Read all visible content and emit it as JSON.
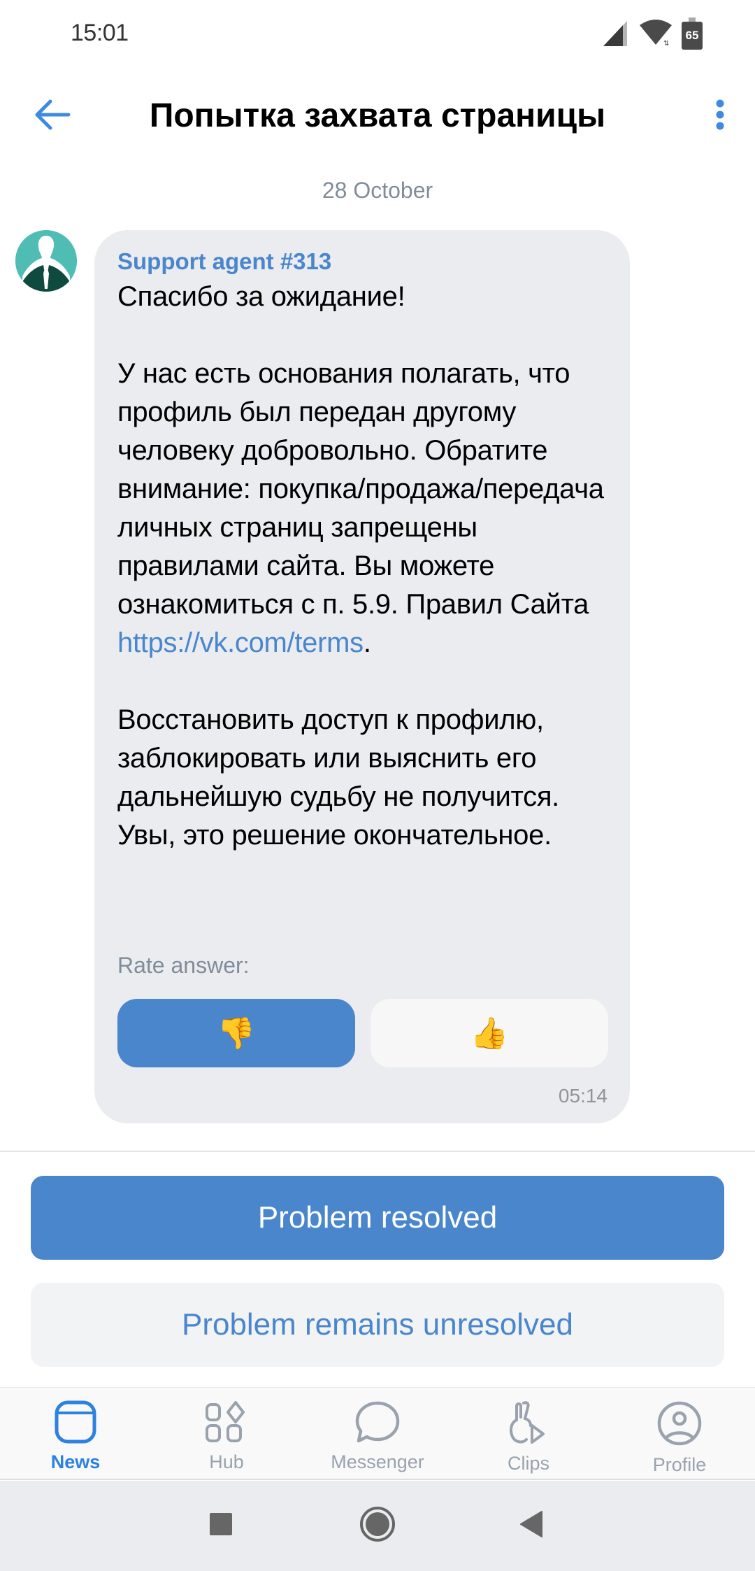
{
  "status_bar": {
    "time": "15:01",
    "battery_level": "65",
    "icons": [
      "signal-icon",
      "wifi-icon",
      "battery-icon"
    ]
  },
  "header": {
    "title": "Попытка захвата страницы",
    "back_icon": "arrow-left-icon",
    "more_icon": "more-vertical-icon"
  },
  "chat": {
    "date_separator": "28 October",
    "message": {
      "sender": "Support agent #313",
      "text_before_link": "Спасибо за ожидание!\n\nУ нас есть основания полагать, что профиль был передан другому человеку добровольно. Обратите внимание: покупка/продажа/передача личных страниц запрещены правилами сайта. Вы можете ознакомиться с п. 5.9. Правил Сайта\n",
      "link_text": "https://vk.com/terms",
      "text_after_link": ".\n\nВосстановить доступ к профилю, заблокировать или выяснить его дальнейшую судьбу не получится. Увы, это решение окончательное.",
      "rate_label": "Rate answer:",
      "rate_down_emoji": "👎",
      "rate_up_emoji": "👍",
      "rate_selected": "thumbs-down",
      "time": "05:14"
    }
  },
  "actions": {
    "resolved_label": "Problem resolved",
    "unresolved_label": "Problem remains unresolved"
  },
  "tab_bar": {
    "active": "News",
    "tabs": [
      {
        "label": "News",
        "icon": "news-icon"
      },
      {
        "label": "Hub",
        "icon": "hub-icon"
      },
      {
        "label": "Messenger",
        "icon": "messenger-icon"
      },
      {
        "label": "Clips",
        "icon": "clips-icon"
      },
      {
        "label": "Profile",
        "icon": "profile-icon"
      }
    ]
  },
  "colors": {
    "accent": "#4a86cc",
    "tab_active": "#2d81e0",
    "tab_inactive": "#99a2ad",
    "bubble_bg": "#ebecf0",
    "secondary_text": "#818c99"
  }
}
